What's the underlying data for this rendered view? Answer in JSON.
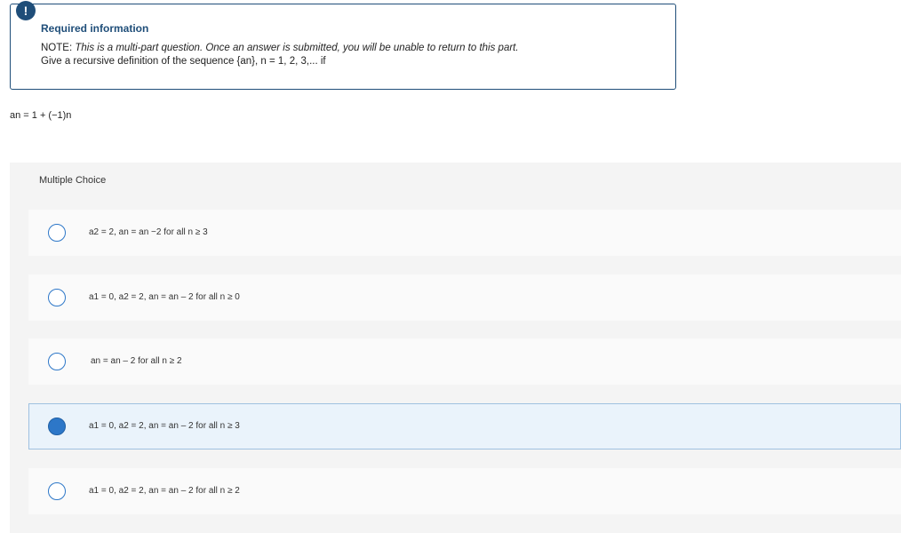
{
  "info": {
    "icon": "!",
    "title": "Required information",
    "note_label": "NOTE: ",
    "note_text": "This is a multi-part question. Once an answer is submitted, you will be unable to return to this part.",
    "prompt": "Give a recursive definition of the sequence {an}, n = 1, 2, 3,... if"
  },
  "formula": "an = 1 + (−1)n",
  "question_type": "Multiple Choice",
  "options": [
    {
      "text": "a2 = 2, an = an −2 for all n ≥ 3",
      "selected": false
    },
    {
      "text": "a1 = 0, a2 = 2, an = an – 2 for all n ≥ 0",
      "selected": false
    },
    {
      "text": "an = an – 2 for all n ≥ 2",
      "selected": false
    },
    {
      "text": "a1 = 0, a2 = 2, an = an – 2 for all n ≥ 3",
      "selected": true
    },
    {
      "text": "a1 = 0, a2 = 2, an = an – 2 for all n ≥ 2",
      "selected": false
    }
  ],
  "colors": {
    "accent": "#1f4e79",
    "radio": "#2d77c8",
    "selected_bg": "#eaf3fb",
    "panel_bg": "#f4f4f4"
  }
}
